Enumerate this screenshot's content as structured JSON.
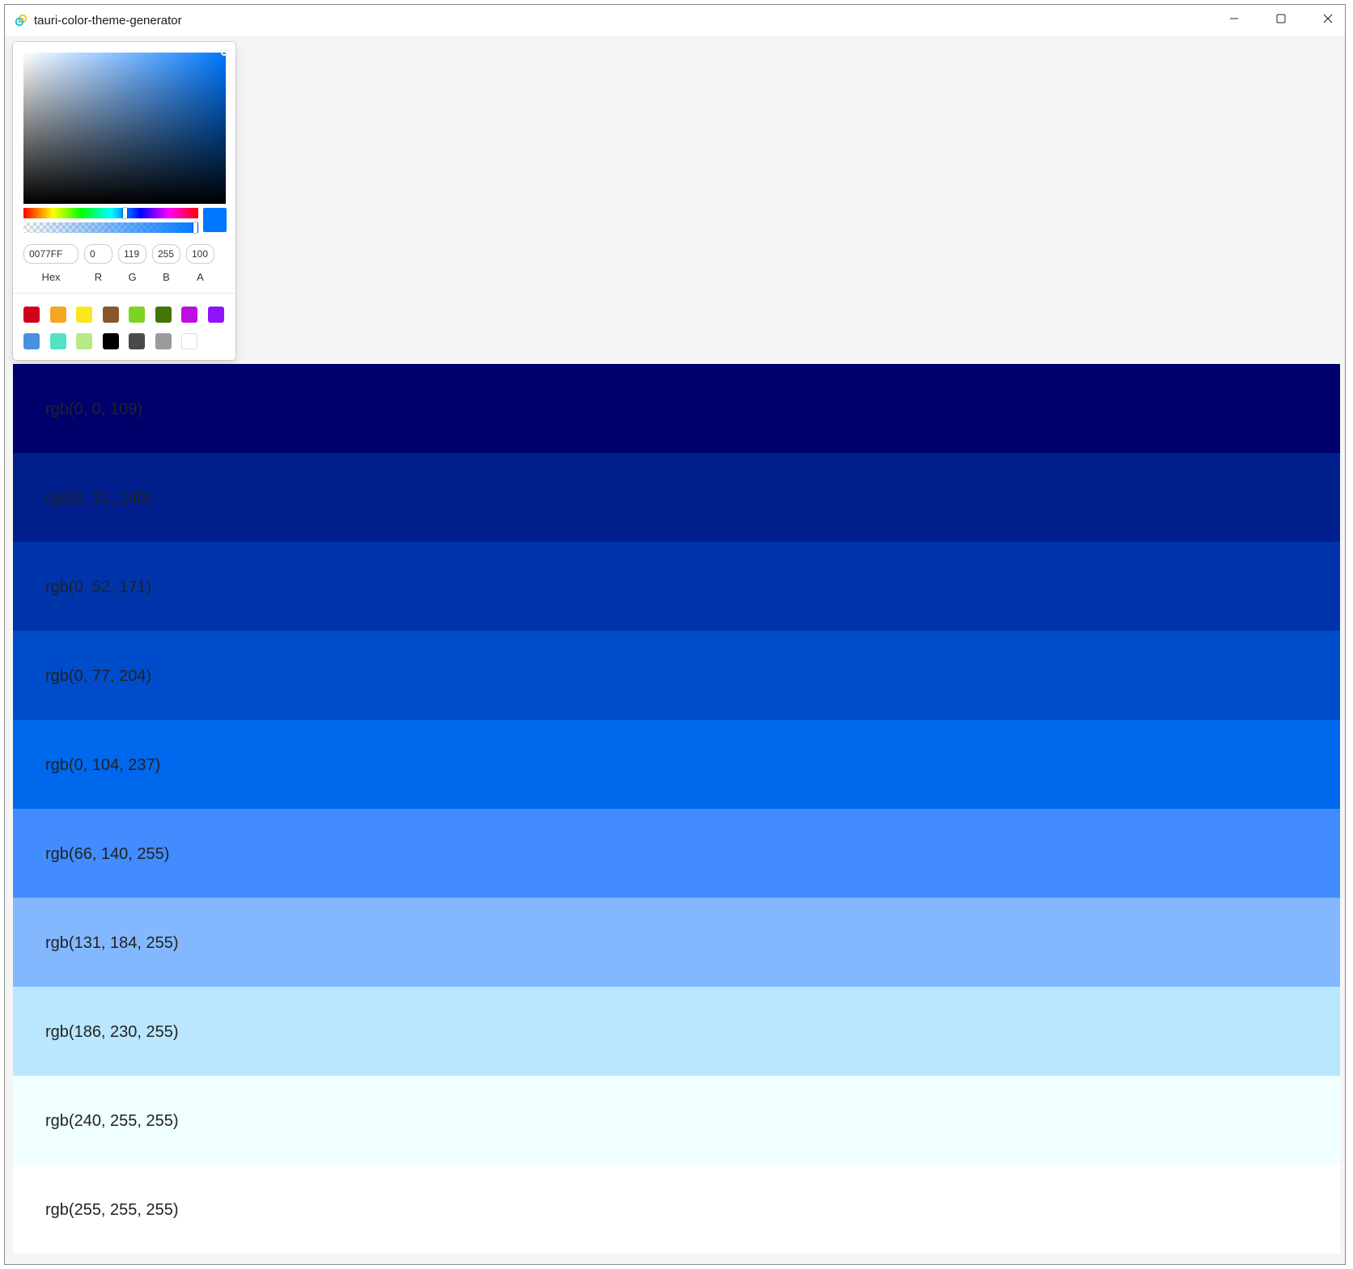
{
  "window": {
    "title": "tauri-color-theme-generator",
    "app_icon": "tauri-logo-icon"
  },
  "controls": {
    "minimize_icon": "minimize-icon",
    "maximize_icon": "maximize-icon",
    "close_icon": "close-icon"
  },
  "picker": {
    "current_color": "#0077FF",
    "hue_position": 0.59,
    "alpha_position": 1.0,
    "hex": "0077FF",
    "r": "0",
    "g": "119",
    "b": "255",
    "a": "100",
    "labels": {
      "hex": "Hex",
      "r": "R",
      "g": "G",
      "b": "B",
      "a": "A"
    },
    "preset_colors": [
      "#D0021B",
      "#F5A623",
      "#F8E71C",
      "#8B572A",
      "#7ED321",
      "#417505",
      "#BD10E0",
      "#9013FE",
      "#4A90E2",
      "#50E3C2",
      "#B8E986",
      "#000000",
      "#4A4A4A",
      "#9B9B9B",
      "#FFFFFF"
    ]
  },
  "shades": [
    {
      "label": "rgb(0, 0, 109)",
      "color": "#00006D"
    },
    {
      "label": "rgb(0, 31, 140)",
      "color": "#001F8C"
    },
    {
      "label": "rgb(0, 52, 171)",
      "color": "#0034AB"
    },
    {
      "label": "rgb(0, 77, 204)",
      "color": "#004DCC"
    },
    {
      "label": "rgb(0, 104, 237)",
      "color": "#0068ED"
    },
    {
      "label": "rgb(66, 140, 255)",
      "color": "#428CFF"
    },
    {
      "label": "rgb(131, 184, 255)",
      "color": "#83B8FF"
    },
    {
      "label": "rgb(186, 230, 255)",
      "color": "#BAE6FF"
    },
    {
      "label": "rgb(240, 255, 255)",
      "color": "#F0FFFF"
    },
    {
      "label": "rgb(255, 255, 255)",
      "color": "#FFFFFF"
    }
  ]
}
